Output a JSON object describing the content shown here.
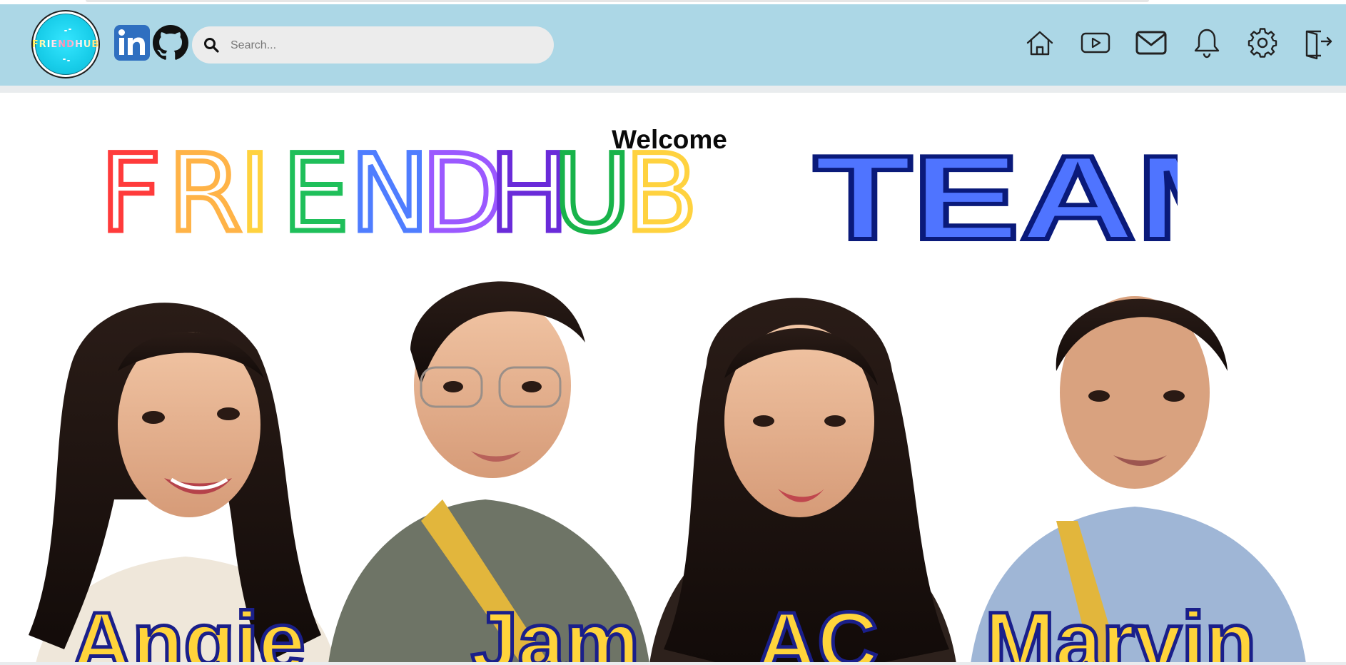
{
  "logo": {
    "text": "FRIENDHUB"
  },
  "social": {
    "linkedin_icon": "linkedin-icon",
    "github_icon": "github-icon"
  },
  "search": {
    "placeholder": "Search...",
    "value": ""
  },
  "nav": {
    "items": [
      {
        "icon": "home-icon"
      },
      {
        "icon": "video-icon"
      },
      {
        "icon": "mail-icon"
      },
      {
        "icon": "bell-icon"
      },
      {
        "icon": "gear-icon"
      },
      {
        "icon": "logout-icon"
      }
    ]
  },
  "main": {
    "welcome": "Welcome",
    "banner": {
      "letters": [
        "F",
        "R",
        "I",
        "E",
        "N",
        "D",
        "H",
        "U",
        "B"
      ],
      "letter_colors": [
        "#ff3b3b",
        "#ffb347",
        "#ffd23f",
        "#1fbf5a",
        "#4f7dff",
        "#9b59ff",
        "#6a2bd9",
        "#18b34a",
        "#ffd23f"
      ],
      "team": "TEAM",
      "team_color": "#4f74ff",
      "team_outline": "#0a1a7a"
    },
    "members": [
      {
        "name": "Angie"
      },
      {
        "name": "Jam"
      },
      {
        "name": "AC"
      },
      {
        "name": "Marvin"
      }
    ],
    "name_color": "#ffd43b",
    "name_outline": "#1a1f8a"
  },
  "colors": {
    "navbar": "#acd7e6",
    "search_bg": "#ececec"
  }
}
